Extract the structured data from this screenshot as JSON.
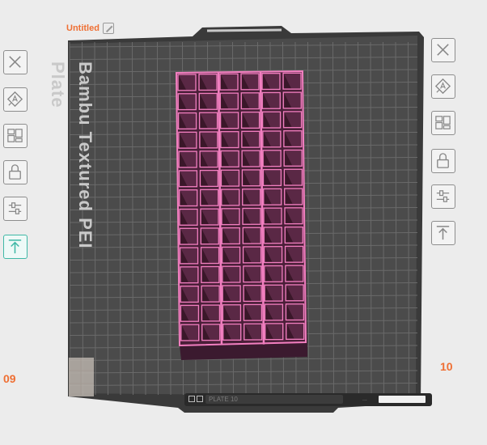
{
  "plate": {
    "title": "Untitled",
    "bed_name": "Bambu Textured PEI Plate",
    "status_text": "PLATE 10",
    "status_mid": "..."
  },
  "plate_numbers": {
    "left": "09",
    "right": "10"
  },
  "left_toolbar": [
    {
      "icon": "close-icon",
      "active": false
    },
    {
      "icon": "auto-orient-icon",
      "active": false
    },
    {
      "icon": "arrange-icon",
      "active": false
    },
    {
      "icon": "lock-icon",
      "active": false
    },
    {
      "icon": "settings-sliders-icon",
      "active": false
    },
    {
      "icon": "move-to-top-icon",
      "active": true
    }
  ],
  "right_toolbar": [
    {
      "icon": "close-icon",
      "active": false
    },
    {
      "icon": "auto-orient-icon",
      "active": false
    },
    {
      "icon": "arrange-icon",
      "active": false
    },
    {
      "icon": "lock-icon",
      "active": false
    },
    {
      "icon": "settings-sliders-icon",
      "active": false
    },
    {
      "icon": "move-to-top-icon",
      "active": false
    }
  ],
  "colors": {
    "accent_orange": "#ef6f33",
    "active_teal": "#3fb8a6",
    "bed": "#4a4a4a",
    "model_edge": "#f27fc0",
    "model_fill": "#4a1f38"
  }
}
